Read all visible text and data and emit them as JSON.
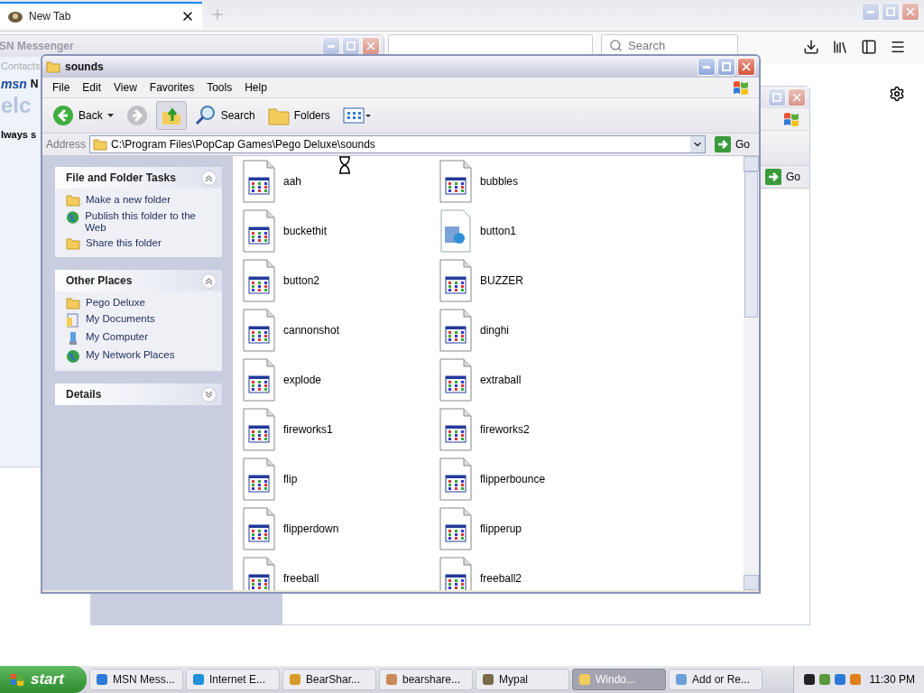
{
  "browser": {
    "tab": {
      "title": "New Tab",
      "selected": true
    },
    "search": {
      "placeholder": "Search"
    }
  },
  "messenger": {
    "title": "SN Messenger",
    "tab": "Contacts",
    "brand": "msn",
    "brand_suffix": "N",
    "welcome": "elc",
    "banner": "lways s"
  },
  "back_window": {
    "go": "Go"
  },
  "explorer": {
    "title": "sounds",
    "menu": [
      "File",
      "Edit",
      "View",
      "Favorites",
      "Tools",
      "Help"
    ],
    "toolbar": [
      {
        "kind": "back",
        "label": "Back",
        "selected": false
      },
      {
        "kind": "forward",
        "selected": false
      },
      {
        "kind": "up",
        "selected": true
      },
      {
        "kind": "search",
        "label": "Search",
        "selected": false
      },
      {
        "kind": "folders",
        "label": "Folders",
        "selected": false
      },
      {
        "kind": "views",
        "selected": false
      }
    ],
    "address": {
      "label": "Address",
      "value": "C:\\Program Files\\PopCap Games\\Pego Deluxe\\sounds",
      "go": "Go"
    },
    "panels": [
      {
        "title": "File and Folder Tasks",
        "expanded": true,
        "items": [
          {
            "kind": "newfolder",
            "label": "Make a new folder"
          },
          {
            "kind": "web",
            "label": "Publish this folder to the Web"
          },
          {
            "kind": "share",
            "label": "Share this folder"
          }
        ]
      },
      {
        "title": "Other Places",
        "expanded": true,
        "items": [
          {
            "kind": "folder",
            "label": "Pego Deluxe"
          },
          {
            "kind": "documents",
            "label": "My Documents"
          },
          {
            "kind": "computer",
            "label": "My Computer"
          },
          {
            "kind": "network",
            "label": "My Network Places"
          }
        ]
      },
      {
        "title": "Details",
        "expanded": false
      }
    ],
    "files": [
      {
        "name": "aah",
        "kind": "sound"
      },
      {
        "name": "bubbles",
        "kind": "sound"
      },
      {
        "name": "buckethit",
        "kind": "sound"
      },
      {
        "name": "button1",
        "kind": "media"
      },
      {
        "name": "button2",
        "kind": "sound"
      },
      {
        "name": "BUZZER",
        "kind": "sound"
      },
      {
        "name": "cannonshot",
        "kind": "sound"
      },
      {
        "name": "dinghi",
        "kind": "sound"
      },
      {
        "name": "explode",
        "kind": "sound"
      },
      {
        "name": "extraball",
        "kind": "sound"
      },
      {
        "name": "fireworks1",
        "kind": "sound"
      },
      {
        "name": "fireworks2",
        "kind": "sound"
      },
      {
        "name": "flip",
        "kind": "sound"
      },
      {
        "name": "flipperbounce",
        "kind": "sound"
      },
      {
        "name": "flipperdown",
        "kind": "sound"
      },
      {
        "name": "flipperup",
        "kind": "sound"
      },
      {
        "name": "freeball",
        "kind": "sound"
      },
      {
        "name": "freeball2",
        "kind": "sound"
      }
    ]
  },
  "taskbar": {
    "start": "start",
    "buttons": [
      {
        "kind": "messenger",
        "label": "MSN Mess...",
        "selected": false
      },
      {
        "kind": "browser",
        "label": "Internet E...",
        "selected": false
      },
      {
        "kind": "bear",
        "label": "BearShar...",
        "selected": false
      },
      {
        "kind": "bear2",
        "label": "bearshare...",
        "selected": false
      },
      {
        "kind": "mypal",
        "label": "Mypal",
        "selected": false
      },
      {
        "kind": "folder",
        "label": "Windo...",
        "selected": true
      },
      {
        "kind": "addremove",
        "label": "Add or Re...",
        "selected": false
      }
    ],
    "clock": "11:30 PM"
  }
}
